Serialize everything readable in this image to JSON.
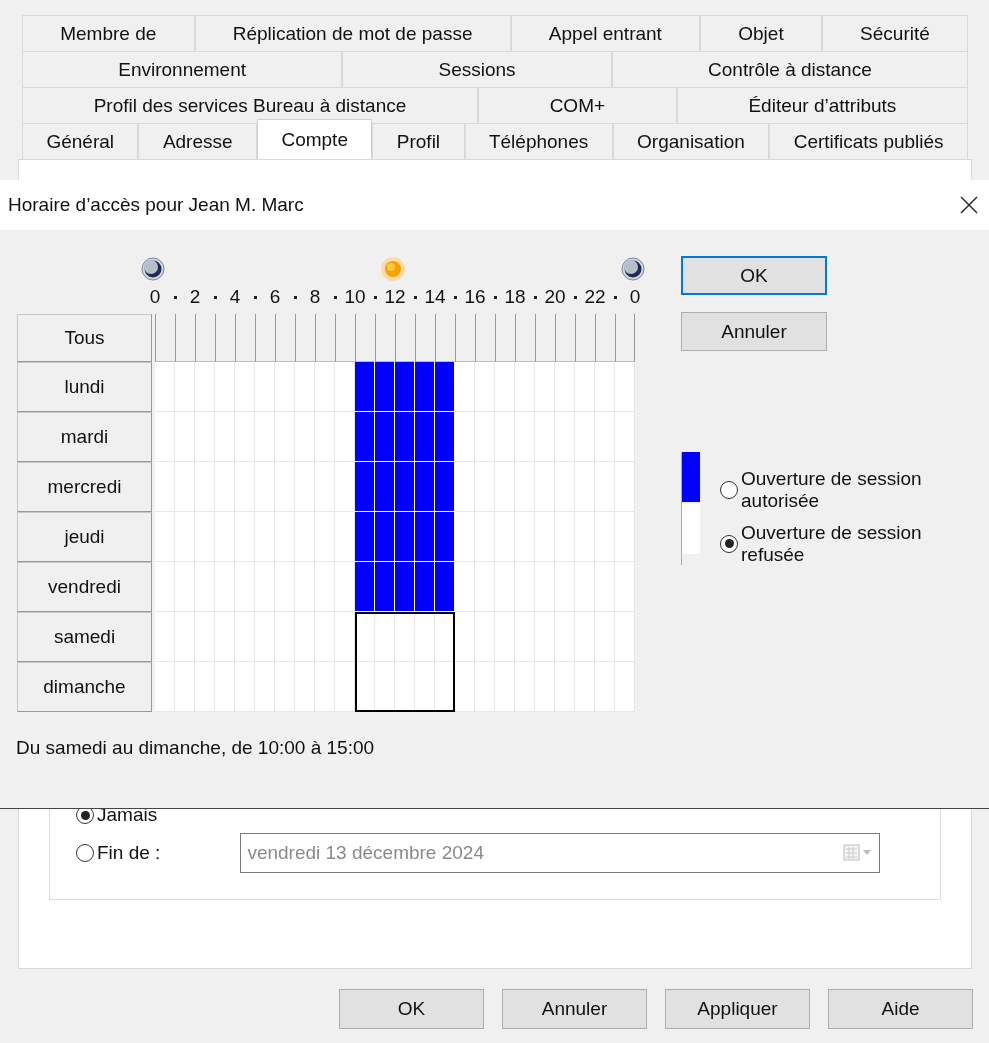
{
  "tab_rows": [
    {
      "tabs": [
        {
          "label": "Membre de",
          "selected": false
        },
        {
          "label": "Réplication de mot de passe",
          "selected": false
        },
        {
          "label": "Appel entrant",
          "selected": false
        },
        {
          "label": "Objet",
          "selected": false
        },
        {
          "label": "Sécurité",
          "selected": false
        }
      ]
    },
    {
      "tabs": [
        {
          "label": "Environnement",
          "selected": false
        },
        {
          "label": "Sessions",
          "selected": false
        },
        {
          "label": "Contrôle à distance",
          "selected": false
        }
      ]
    },
    {
      "tabs": [
        {
          "label": "Profil des services Bureau à distance",
          "selected": false
        },
        {
          "label": "COM+",
          "selected": false
        },
        {
          "label": "Éditeur d’attributs",
          "selected": false
        }
      ]
    },
    {
      "tabs": [
        {
          "label": "Général",
          "selected": false
        },
        {
          "label": "Adresse",
          "selected": false
        },
        {
          "label": "Compte",
          "selected": true
        },
        {
          "label": "Profil",
          "selected": false
        },
        {
          "label": "Téléphones",
          "selected": false
        },
        {
          "label": "Organisation",
          "selected": false
        },
        {
          "label": "Certificats publiés",
          "selected": false
        }
      ]
    }
  ],
  "expiration": {
    "options": [
      {
        "label": "Jamais",
        "selected": true
      },
      {
        "label": "Fin de :",
        "selected": false
      }
    ],
    "date_field": {
      "value": "vendredi  13 décembre 2024",
      "disabled": true
    }
  },
  "buttons": [
    "OK",
    "Annuler",
    "Appliquer",
    "Aide"
  ],
  "dialog": {
    "title": "Horaire d’accès pour Jean M. Marc",
    "hour_labels": [
      "0",
      "2",
      "4",
      "6",
      "8",
      "10",
      "12",
      "14",
      "16",
      "18",
      "20",
      "22",
      "0"
    ],
    "all_label": "Tous",
    "hours": [
      {
        "selected": false
      },
      {
        "selected": false
      },
      {
        "selected": false
      },
      {
        "selected": false
      },
      {
        "selected": false
      },
      {
        "selected": false
      },
      {
        "selected": false
      },
      {
        "selected": false
      },
      {
        "selected": false
      },
      {
        "selected": false
      },
      {
        "selected": true
      },
      {
        "selected": true
      },
      {
        "selected": true
      },
      {
        "selected": true
      },
      {
        "selected": true
      },
      {
        "selected": false
      },
      {
        "selected": false
      },
      {
        "selected": false
      },
      {
        "selected": false
      },
      {
        "selected": false
      },
      {
        "selected": false
      },
      {
        "selected": false
      },
      {
        "selected": false
      },
      {
        "selected": false
      }
    ],
    "days": [
      {
        "label": "lundi",
        "selected": false,
        "slots": [
          false,
          false,
          false,
          false,
          false,
          false,
          false,
          false,
          false,
          false,
          true,
          true,
          true,
          true,
          true,
          false,
          false,
          false,
          false,
          false,
          false,
          false,
          false,
          false
        ]
      },
      {
        "label": "mardi",
        "selected": false,
        "slots": [
          false,
          false,
          false,
          false,
          false,
          false,
          false,
          false,
          false,
          false,
          true,
          true,
          true,
          true,
          true,
          false,
          false,
          false,
          false,
          false,
          false,
          false,
          false,
          false
        ]
      },
      {
        "label": "mercredi",
        "selected": false,
        "slots": [
          false,
          false,
          false,
          false,
          false,
          false,
          false,
          false,
          false,
          false,
          true,
          true,
          true,
          true,
          true,
          false,
          false,
          false,
          false,
          false,
          false,
          false,
          false,
          false
        ]
      },
      {
        "label": "jeudi",
        "selected": false,
        "slots": [
          false,
          false,
          false,
          false,
          false,
          false,
          false,
          false,
          false,
          false,
          true,
          true,
          true,
          true,
          true,
          false,
          false,
          false,
          false,
          false,
          false,
          false,
          false,
          false
        ]
      },
      {
        "label": "vendredi",
        "selected": false,
        "slots": [
          false,
          false,
          false,
          false,
          false,
          false,
          false,
          false,
          false,
          false,
          true,
          true,
          true,
          true,
          true,
          false,
          false,
          false,
          false,
          false,
          false,
          false,
          false,
          false
        ]
      },
      {
        "label": "samedi",
        "selected": true,
        "slots": [
          false,
          false,
          false,
          false,
          false,
          false,
          false,
          false,
          false,
          false,
          false,
          false,
          false,
          false,
          false,
          false,
          false,
          false,
          false,
          false,
          false,
          false,
          false,
          false
        ]
      },
      {
        "label": "dimanche",
        "selected": true,
        "slots": [
          false,
          false,
          false,
          false,
          false,
          false,
          false,
          false,
          false,
          false,
          false,
          false,
          false,
          false,
          false,
          false,
          false,
          false,
          false,
          false,
          false,
          false,
          false,
          false
        ]
      }
    ],
    "buttons": [
      {
        "label": "OK",
        "default": true
      },
      {
        "label": "Annuler",
        "default": false
      }
    ],
    "legend": [
      {
        "label": "Ouverture de session autorisée",
        "kind": "allowed",
        "selected": false
      },
      {
        "label": "Ouverture de session refusée",
        "kind": "denied",
        "selected": true
      }
    ],
    "status": "Du samedi au dimanche, de 10:00 à 15:00"
  }
}
